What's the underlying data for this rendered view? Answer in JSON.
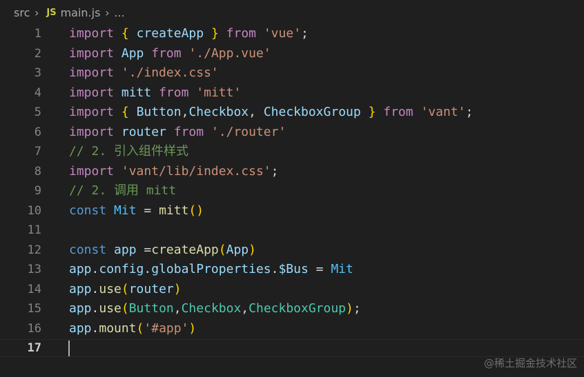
{
  "breadcrumb": {
    "folder": "src",
    "file_badge": "JS",
    "file": "main.js",
    "ellipsis": "..."
  },
  "editor": {
    "current_line": "17",
    "lines": [
      {
        "n": "1",
        "tokens": [
          [
            "kw",
            "import"
          ],
          [
            "plain",
            " "
          ],
          [
            "br1",
            "{"
          ],
          [
            "plain",
            " "
          ],
          [
            "var",
            "createApp"
          ],
          [
            "plain",
            " "
          ],
          [
            "br1",
            "}"
          ],
          [
            "plain",
            " "
          ],
          [
            "kw",
            "from"
          ],
          [
            "plain",
            " "
          ],
          [
            "str",
            "'vue'"
          ],
          [
            "plain",
            ";"
          ]
        ]
      },
      {
        "n": "2",
        "tokens": [
          [
            "kw",
            "import"
          ],
          [
            "plain",
            " "
          ],
          [
            "var",
            "App"
          ],
          [
            "plain",
            " "
          ],
          [
            "kw",
            "from"
          ],
          [
            "plain",
            " "
          ],
          [
            "str",
            "'./App.vue'"
          ]
        ]
      },
      {
        "n": "3",
        "tokens": [
          [
            "kw",
            "import"
          ],
          [
            "plain",
            " "
          ],
          [
            "str",
            "'./index.css'"
          ]
        ]
      },
      {
        "n": "4",
        "tokens": [
          [
            "kw",
            "import"
          ],
          [
            "plain",
            " "
          ],
          [
            "var",
            "mitt"
          ],
          [
            "plain",
            " "
          ],
          [
            "kw",
            "from"
          ],
          [
            "plain",
            " "
          ],
          [
            "str",
            "'mitt'"
          ]
        ]
      },
      {
        "n": "5",
        "tokens": [
          [
            "kw",
            "import"
          ],
          [
            "plain",
            " "
          ],
          [
            "br1",
            "{"
          ],
          [
            "plain",
            " "
          ],
          [
            "var",
            "Button"
          ],
          [
            "plain",
            ","
          ],
          [
            "var",
            "Checkbox"
          ],
          [
            "plain",
            ", "
          ],
          [
            "var",
            "CheckboxGroup"
          ],
          [
            "plain",
            " "
          ],
          [
            "br1",
            "}"
          ],
          [
            "plain",
            " "
          ],
          [
            "kw",
            "from"
          ],
          [
            "plain",
            " "
          ],
          [
            "str",
            "'vant'"
          ],
          [
            "plain",
            ";"
          ]
        ]
      },
      {
        "n": "6",
        "tokens": [
          [
            "kw",
            "import"
          ],
          [
            "plain",
            " "
          ],
          [
            "var",
            "router"
          ],
          [
            "plain",
            " "
          ],
          [
            "kw",
            "from"
          ],
          [
            "plain",
            " "
          ],
          [
            "str",
            "'./router'"
          ]
        ]
      },
      {
        "n": "7",
        "tokens": [
          [
            "cm",
            "// 2. 引入组件样式"
          ]
        ]
      },
      {
        "n": "8",
        "tokens": [
          [
            "kw",
            "import"
          ],
          [
            "plain",
            " "
          ],
          [
            "str",
            "'vant/lib/index.css'"
          ],
          [
            "plain",
            ";"
          ]
        ]
      },
      {
        "n": "9",
        "tokens": [
          [
            "cm",
            "// 2. 调用 mitt"
          ]
        ]
      },
      {
        "n": "10",
        "tokens": [
          [
            "kwb",
            "const"
          ],
          [
            "plain",
            " "
          ],
          [
            "const",
            "Mit"
          ],
          [
            "plain",
            " = "
          ],
          [
            "fn",
            "mitt"
          ],
          [
            "br1",
            "()"
          ]
        ]
      },
      {
        "n": "11",
        "tokens": []
      },
      {
        "n": "12",
        "tokens": [
          [
            "kwb",
            "const"
          ],
          [
            "plain",
            " "
          ],
          [
            "var",
            "app"
          ],
          [
            "plain",
            " ="
          ],
          [
            "fn",
            "createApp"
          ],
          [
            "br1",
            "("
          ],
          [
            "var",
            "App"
          ],
          [
            "br1",
            ")"
          ]
        ]
      },
      {
        "n": "13",
        "tokens": [
          [
            "var",
            "app"
          ],
          [
            "plain",
            "."
          ],
          [
            "var",
            "config"
          ],
          [
            "plain",
            "."
          ],
          [
            "var",
            "globalProperties"
          ],
          [
            "plain",
            "."
          ],
          [
            "var",
            "$Bus"
          ],
          [
            "plain",
            " = "
          ],
          [
            "const",
            "Mit"
          ]
        ]
      },
      {
        "n": "14",
        "tokens": [
          [
            "var",
            "app"
          ],
          [
            "plain",
            "."
          ],
          [
            "fn",
            "use"
          ],
          [
            "br1",
            "("
          ],
          [
            "var",
            "router"
          ],
          [
            "br1",
            ")"
          ]
        ]
      },
      {
        "n": "15",
        "tokens": [
          [
            "var",
            "app"
          ],
          [
            "plain",
            "."
          ],
          [
            "fn",
            "use"
          ],
          [
            "br1",
            "("
          ],
          [
            "cls",
            "Button"
          ],
          [
            "plain",
            ","
          ],
          [
            "cls",
            "Checkbox"
          ],
          [
            "plain",
            ","
          ],
          [
            "cls",
            "CheckboxGroup"
          ],
          [
            "br1",
            ")"
          ],
          [
            "plain",
            ";"
          ]
        ]
      },
      {
        "n": "16",
        "tokens": [
          [
            "var",
            "app"
          ],
          [
            "plain",
            "."
          ],
          [
            "fn",
            "mount"
          ],
          [
            "br1",
            "("
          ],
          [
            "str",
            "'#app'"
          ],
          [
            "br1",
            ")"
          ]
        ]
      },
      {
        "n": "17",
        "tokens": []
      }
    ]
  },
  "watermark": "@稀土掘金技术社区"
}
